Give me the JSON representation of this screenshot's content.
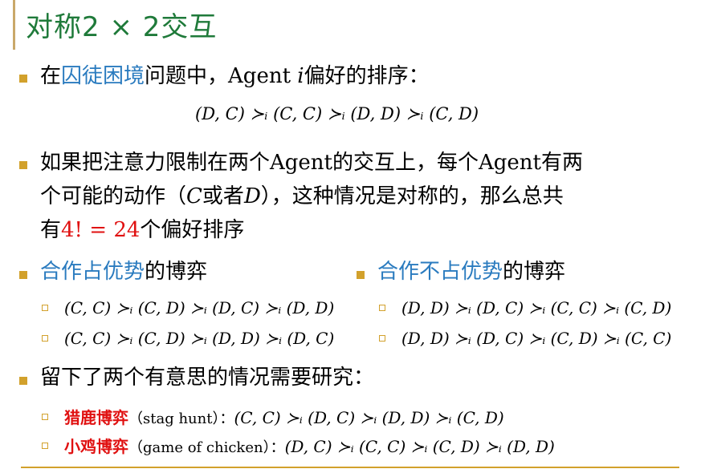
{
  "title": "对称2 × 2交互",
  "bullet1": {
    "prefix": "在",
    "link": "囚徒困境",
    "suffix": "问题中，Agent ",
    "agent_i": "i",
    "tail": "偏好的排序：",
    "formula": "(D, C) ≻ᵢ (C, C) ≻ᵢ (D, D) ≻ᵢ (C, D)"
  },
  "bullet2": {
    "line1": "如果把注意力限制在两个Agent的交互上，每个Agent有两",
    "line2_a": "个可能的动作（",
    "line2_C": "C",
    "line2_b": "或者",
    "line2_D": "D",
    "line2_c": "），这种情况是对称的，那么总共",
    "line3_a": "有",
    "line3_red": "4! = 24",
    "line3_b": "个偏好排序"
  },
  "coop_dominant": {
    "label_blue": "合作占优势",
    "label_rest": "的博弈",
    "items": [
      "(C, C) ≻ᵢ (C, D) ≻ᵢ (D, C) ≻ᵢ (D, D)",
      "(C, C) ≻ᵢ (C, D) ≻ᵢ (D, D) ≻ᵢ (D, C)"
    ]
  },
  "coop_not_dominant": {
    "label_blue": "合作不占优势",
    "label_rest": "的博弈",
    "items": [
      "(D, D) ≻ᵢ (D, C) ≻ᵢ (C, C) ≻ᵢ (C, D)",
      "(D, D) ≻ᵢ (D, C) ≻ᵢ (C, D) ≻ᵢ (C, C)"
    ]
  },
  "bullet4": {
    "text": "留下了两个有意思的情况需要研究：",
    "items": [
      {
        "name": "猎鹿博弈",
        "english": "（stag hunt）：",
        "formula": "(C, C) ≻ᵢ (D, C) ≻ᵢ (D, D) ≻ᵢ (C, D)"
      },
      {
        "name": "小鸡博弈",
        "english": "（game of chicken）：",
        "formula": "(D, C) ≻ᵢ (C, C) ≻ᵢ (C, D) ≻ᵢ (D, D)"
      }
    ]
  },
  "colors": {
    "title": "#1f7a3a",
    "accent": "#d2a12c",
    "link": "#2a7bbf",
    "highlight": "#e01010"
  }
}
